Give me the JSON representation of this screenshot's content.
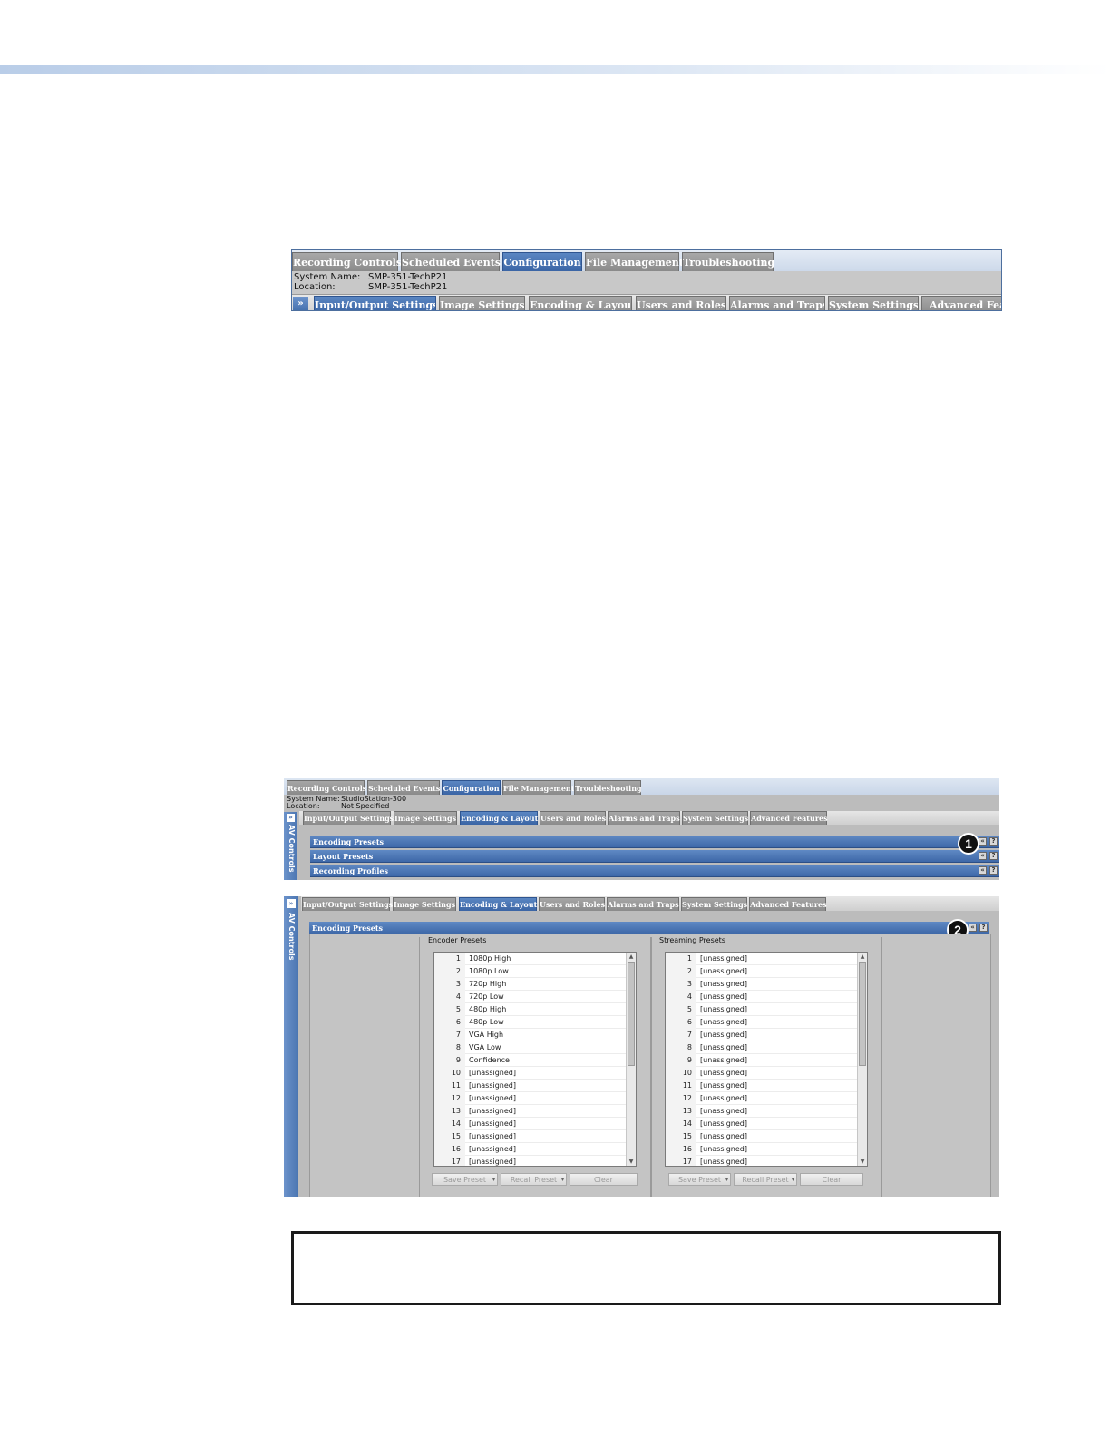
{
  "shot1": {
    "tabs": [
      "Recording Controls",
      "Scheduled Events",
      "Configuration",
      "File Management",
      "Troubleshooting"
    ],
    "active_tab": 2,
    "system_name_label": "System Name:",
    "system_name": "SMP-351-TechP21",
    "location_label": "Location:",
    "location": "SMP-351-TechP21",
    "expand_glyph": "»",
    "subtabs": [
      "Input/Output Settings",
      "Image Settings",
      "Encoding & Layout",
      "Users and Roles",
      "Alarms and Traps",
      "System Settings",
      "Advanced Featu"
    ]
  },
  "shot2": {
    "tabs": [
      "Recording Controls",
      "Scheduled Events",
      "Configuration",
      "File Management",
      "Troubleshooting"
    ],
    "system_name_label": "System Name:",
    "system_name": "StudioStation-300",
    "location_label": "Location:",
    "location": "Not Specified",
    "side_label": "AV Controls",
    "expand_glyph": "»",
    "subtabs": [
      "Input/Output Settings",
      "Image Settings",
      "Encoding & Layout",
      "Users and Roles",
      "Alarms and Traps",
      "System Settings",
      "Advanced Features"
    ],
    "sections": [
      "Encoding Presets",
      "Layout Presets",
      "Recording Profiles"
    ],
    "callout": "1",
    "btn_collapse": "«",
    "btn_help": "?"
  },
  "shot3": {
    "side_label": "AV Controls",
    "expand_glyph": "»",
    "subtabs": [
      "Input/Output Settings",
      "Image Settings",
      "Encoding & Layout",
      "Users and Roles",
      "Alarms and Traps",
      "System Settings",
      "Advanced Features"
    ],
    "section": "Encoding Presets",
    "callout": "2",
    "btn_collapse": "«",
    "btn_help": "?",
    "encoder": {
      "title": "Encoder Presets",
      "rows": [
        {
          "num": "1",
          "name": "1080p High"
        },
        {
          "num": "2",
          "name": "1080p Low"
        },
        {
          "num": "3",
          "name": "720p High"
        },
        {
          "num": "4",
          "name": "720p Low"
        },
        {
          "num": "5",
          "name": "480p High"
        },
        {
          "num": "6",
          "name": "480p Low"
        },
        {
          "num": "7",
          "name": "VGA High"
        },
        {
          "num": "8",
          "name": "VGA Low"
        },
        {
          "num": "9",
          "name": "Confidence"
        },
        {
          "num": "10",
          "name": "[unassigned]"
        },
        {
          "num": "11",
          "name": "[unassigned]"
        },
        {
          "num": "12",
          "name": "[unassigned]"
        },
        {
          "num": "13",
          "name": "[unassigned]"
        },
        {
          "num": "14",
          "name": "[unassigned]"
        },
        {
          "num": "15",
          "name": "[unassigned]"
        },
        {
          "num": "16",
          "name": "[unassigned]"
        },
        {
          "num": "17",
          "name": "[unassigned]"
        }
      ],
      "save_btn": "Save Preset",
      "recall_btn": "Recall Preset",
      "clear_btn": "Clear"
    },
    "streaming": {
      "title": "Streaming Presets",
      "rows": [
        {
          "num": "1",
          "name": "[unassigned]"
        },
        {
          "num": "2",
          "name": "[unassigned]"
        },
        {
          "num": "3",
          "name": "[unassigned]"
        },
        {
          "num": "4",
          "name": "[unassigned]"
        },
        {
          "num": "5",
          "name": "[unassigned]"
        },
        {
          "num": "6",
          "name": "[unassigned]"
        },
        {
          "num": "7",
          "name": "[unassigned]"
        },
        {
          "num": "8",
          "name": "[unassigned]"
        },
        {
          "num": "9",
          "name": "[unassigned]"
        },
        {
          "num": "10",
          "name": "[unassigned]"
        },
        {
          "num": "11",
          "name": "[unassigned]"
        },
        {
          "num": "12",
          "name": "[unassigned]"
        },
        {
          "num": "13",
          "name": "[unassigned]"
        },
        {
          "num": "14",
          "name": "[unassigned]"
        },
        {
          "num": "15",
          "name": "[unassigned]"
        },
        {
          "num": "16",
          "name": "[unassigned]"
        },
        {
          "num": "17",
          "name": "[unassigned]"
        }
      ],
      "save_btn": "Save Preset",
      "recall_btn": "Recall Preset",
      "clear_btn": "Clear"
    },
    "dropdown_glyph": "▾",
    "scroll_up": "▲",
    "scroll_down": "▼"
  },
  "colors": {
    "active_tab": "#3b65a5",
    "inactive_tab": "#8a8a8a",
    "panel_bg": "#bcbcbc"
  }
}
